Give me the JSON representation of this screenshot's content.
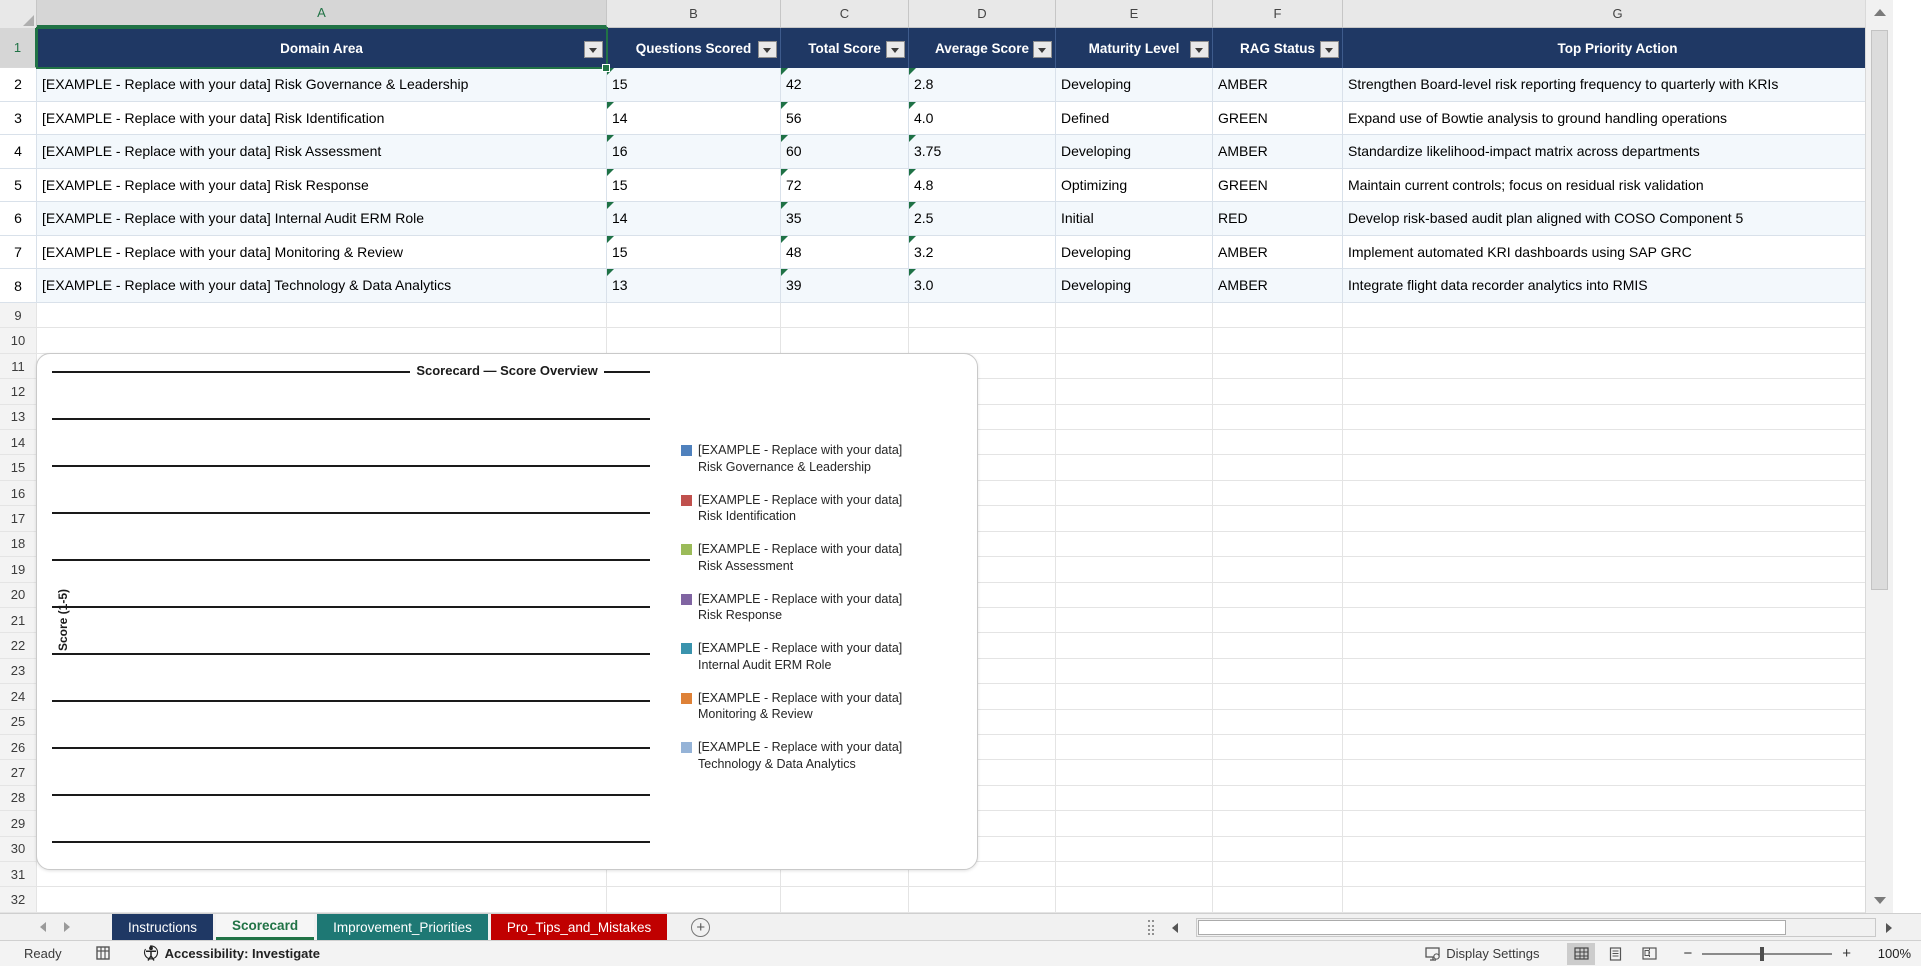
{
  "grid": {
    "column_letters": [
      "A",
      "B",
      "C",
      "D",
      "E",
      "F",
      "G"
    ],
    "rows_visible": {
      "first": 1,
      "last": 32
    },
    "selected_column": "A",
    "selected_row": "1",
    "header_fill_color": "#1F3864",
    "banded_row_color": "#F3F8FC",
    "selection_color": "#217346"
  },
  "table": {
    "headers": [
      "Domain Area",
      "Questions Scored",
      "Total Score",
      "Average Score",
      "Maturity Level",
      "RAG Status",
      "Top Priority Action"
    ],
    "rows": [
      {
        "domain_area": "[EXAMPLE - Replace with your data] Risk Governance & Leadership",
        "questions_scored": "15",
        "total_score": "42",
        "average_score": "2.8",
        "maturity_level": "Developing",
        "rag_status": "AMBER",
        "top_priority_action": "Strengthen Board-level risk reporting frequency to quarterly with KRIs"
      },
      {
        "domain_area": "[EXAMPLE - Replace with your data] Risk Identification",
        "questions_scored": "14",
        "total_score": "56",
        "average_score": "4.0",
        "maturity_level": "Defined",
        "rag_status": "GREEN",
        "top_priority_action": "Expand use of Bowtie analysis to ground handling operations"
      },
      {
        "domain_area": "[EXAMPLE - Replace with your data] Risk Assessment",
        "questions_scored": "16",
        "total_score": "60",
        "average_score": "3.75",
        "maturity_level": "Developing",
        "rag_status": "AMBER",
        "top_priority_action": "Standardize likelihood-impact matrix across departments"
      },
      {
        "domain_area": "[EXAMPLE - Replace with your data] Risk Response",
        "questions_scored": "15",
        "total_score": "72",
        "average_score": "4.8",
        "maturity_level": "Optimizing",
        "rag_status": "GREEN",
        "top_priority_action": "Maintain current controls; focus on residual risk validation"
      },
      {
        "domain_area": "[EXAMPLE - Replace with your data] Internal Audit ERM Role",
        "questions_scored": "14",
        "total_score": "35",
        "average_score": "2.5",
        "maturity_level": "Initial",
        "rag_status": "RED",
        "top_priority_action": "Develop risk-based audit plan aligned with COSO Component 5"
      },
      {
        "domain_area": "[EXAMPLE - Replace with your data] Monitoring & Review",
        "questions_scored": "15",
        "total_score": "48",
        "average_score": "3.2",
        "maturity_level": "Developing",
        "rag_status": "AMBER",
        "top_priority_action": "Implement automated KRI dashboards using SAP GRC"
      },
      {
        "domain_area": "[EXAMPLE - Replace with your data] Technology & Data Analytics",
        "questions_scored": "13",
        "total_score": "39",
        "average_score": "3.0",
        "maturity_level": "Developing",
        "rag_status": "AMBER",
        "top_priority_action": "Integrate flight data recorder analytics into RMIS"
      }
    ]
  },
  "chart": {
    "title": "Scorecard — Score Overview",
    "y_axis_label": "Score (1-5)",
    "gridline_count": 11,
    "legend": [
      {
        "label": "[EXAMPLE - Replace with your data] Risk Governance & Leadership",
        "color": "#4F81BD"
      },
      {
        "label": "[EXAMPLE - Replace with your data] Risk Identification",
        "color": "#C0504D"
      },
      {
        "label": "[EXAMPLE - Replace with your data] Risk Assessment",
        "color": "#9BBB59"
      },
      {
        "label": "[EXAMPLE - Replace with your data] Risk Response",
        "color": "#8064A2"
      },
      {
        "label": "[EXAMPLE - Replace with your data] Internal Audit ERM Role",
        "color": "#3A93AD"
      },
      {
        "label": "[EXAMPLE - Replace with your data] Monitoring & Review",
        "color": "#DE8137"
      },
      {
        "label": "[EXAMPLE - Replace with your data] Technology & Data Analytics",
        "color": "#95B3D7"
      }
    ]
  },
  "chart_data": {
    "type": "bar",
    "title": "Scorecard — Score Overview",
    "ylabel": "Score (1-5)",
    "ylim": [
      0,
      5
    ],
    "gridlines": true,
    "legend_position": "right",
    "series": [
      {
        "name": "[EXAMPLE - Replace with your data] Risk Governance & Leadership",
        "values": []
      },
      {
        "name": "[EXAMPLE - Replace with your data] Risk Identification",
        "values": []
      },
      {
        "name": "[EXAMPLE - Replace with your data] Risk Assessment",
        "values": []
      },
      {
        "name": "[EXAMPLE - Replace with your data] Risk Response",
        "values": []
      },
      {
        "name": "[EXAMPLE - Replace with your data] Internal Audit ERM Role",
        "values": []
      },
      {
        "name": "[EXAMPLE - Replace with your data] Monitoring & Review",
        "values": []
      },
      {
        "name": "[EXAMPLE - Replace with your data] Technology & Data Analytics",
        "values": []
      }
    ],
    "note": "plot area renders horizontal gridlines only; no bars are drawn in the screenshot"
  },
  "sheet_tabs": [
    {
      "label": "Instructions",
      "bg": "#1F3864",
      "fg": "#FFFFFF",
      "active": false
    },
    {
      "label": "Scorecard",
      "bg": "#F6F6F6",
      "fg": "#217346",
      "active": true
    },
    {
      "label": "Improvement_Priorities",
      "bg": "#1E7874",
      "fg": "#FFFFFF",
      "active": false
    },
    {
      "label": "Pro_Tips_and_Mistakes",
      "bg": "#C00000",
      "fg": "#FFFFFF",
      "active": false
    }
  ],
  "status_bar": {
    "mode": "Ready",
    "accessibility": "Accessibility: Investigate",
    "display_settings": "Display Settings",
    "zoom_out": "−",
    "zoom_in": "+",
    "zoom_level": "100%"
  }
}
